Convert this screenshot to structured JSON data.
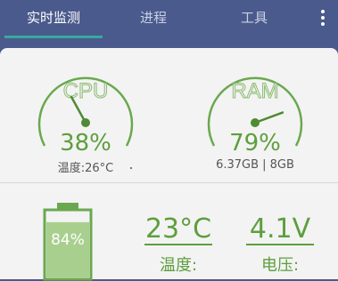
{
  "tabs": [
    {
      "label": "实时监测",
      "active": true
    },
    {
      "label": "进程",
      "active": false
    },
    {
      "label": "工具",
      "active": false
    }
  ],
  "cpu": {
    "label": "CPU",
    "percent": "38%",
    "value": 0.38,
    "temp": "温度:26°C"
  },
  "ram": {
    "label": "RAM",
    "percent": "79%",
    "value": 0.79,
    "usage": "6.37GB | 8GB"
  },
  "battery": {
    "percent": "84%",
    "level": 0.84,
    "temperature": "23°C",
    "temperature_label": "温度:",
    "voltage": "4.1V",
    "voltage_label": "电压:"
  },
  "colors": {
    "header": "#4a5a8c",
    "accent_green": "#5e9e3e",
    "indicator": "#39a8a0",
    "panel": "#f3f3f3"
  }
}
